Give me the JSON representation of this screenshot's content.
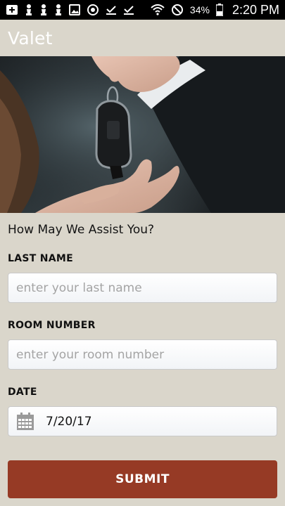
{
  "status_bar": {
    "battery_percent": "34%",
    "time": "2:20 PM",
    "icons": [
      "add-box-icon",
      "chess-pawn-icon",
      "chess-pawn-icon",
      "chess-pawn-icon",
      "image-icon",
      "sync-icon",
      "checkbox-icon",
      "checkbox-icon",
      "wifi-icon",
      "do-not-disturb-icon",
      "battery-icon"
    ]
  },
  "app_bar": {
    "title": "Valet"
  },
  "hero": {
    "image": "hand-passing-car-key-photo"
  },
  "form": {
    "heading": "How May We Assist You?",
    "last_name": {
      "label": "LAST NAME",
      "placeholder": "enter your last name",
      "value": ""
    },
    "room_number": {
      "label": "ROOM NUMBER",
      "placeholder": "enter your room number",
      "value": ""
    },
    "date": {
      "label": "DATE",
      "value": "7/20/17"
    },
    "submit_label": "SUBMIT"
  },
  "colors": {
    "background": "#dad6cb",
    "submit_button": "#963a25",
    "status_bar": "#000000",
    "title_text": "#ffffff"
  }
}
